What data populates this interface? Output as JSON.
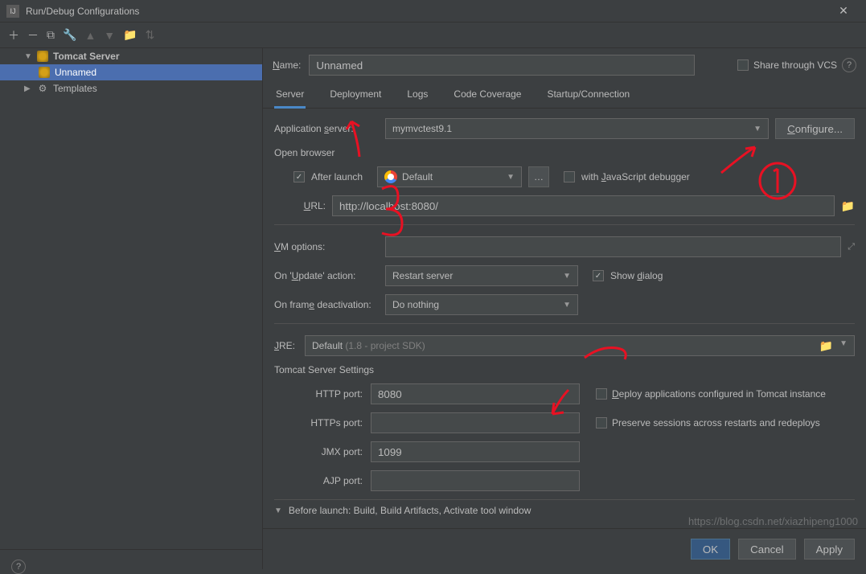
{
  "titlebar": {
    "title": "Run/Debug Configurations"
  },
  "tree": {
    "tomcat_server": "Tomcat Server",
    "unnamed": "Unnamed",
    "templates": "Templates"
  },
  "name": {
    "label": "Name:",
    "value": "Unnamed"
  },
  "share": {
    "label": "Share through VCS"
  },
  "tabs": {
    "server": "Server",
    "deployment": "Deployment",
    "logs": "Logs",
    "code_coverage": "Code Coverage",
    "startup_connection": "Startup/Connection"
  },
  "form": {
    "app_server_label": "Application server:",
    "app_server_value": "mymvctest9.1",
    "configure_btn": "Configure...",
    "open_browser": "Open browser",
    "after_launch": "After launch",
    "browser_default": "Default",
    "with_js_debugger": "with JavaScript debugger",
    "url_label": "URL:",
    "url_value": "http://localhost:8080/",
    "vm_options_label": "VM options:",
    "on_update_label": "On 'Update' action:",
    "on_update_value": "Restart server",
    "show_dialog": "Show dialog",
    "on_frame_label": "On frame deactivation:",
    "on_frame_value": "Do nothing",
    "jre_label": "JRE:",
    "jre_value": "Default",
    "jre_hint": "(1.8 - project SDK)",
    "tomcat_settings": "Tomcat Server Settings",
    "http_port_label": "HTTP port:",
    "http_port_value": "8080",
    "https_port_label": "HTTPs port:",
    "https_port_value": "",
    "jmx_port_label": "JMX port:",
    "jmx_port_value": "1099",
    "ajp_port_label": "AJP port:",
    "ajp_port_value": "",
    "deploy_apps": "Deploy applications configured in Tomcat instance",
    "preserve_sessions": "Preserve sessions across restarts and redeploys",
    "before_launch": "Before launch: Build, Build Artifacts, Activate tool window"
  },
  "buttons": {
    "ok": "OK",
    "cancel": "Cancel",
    "apply": "Apply"
  },
  "watermark": "https://blog.csdn.net/xiazhipeng1000"
}
